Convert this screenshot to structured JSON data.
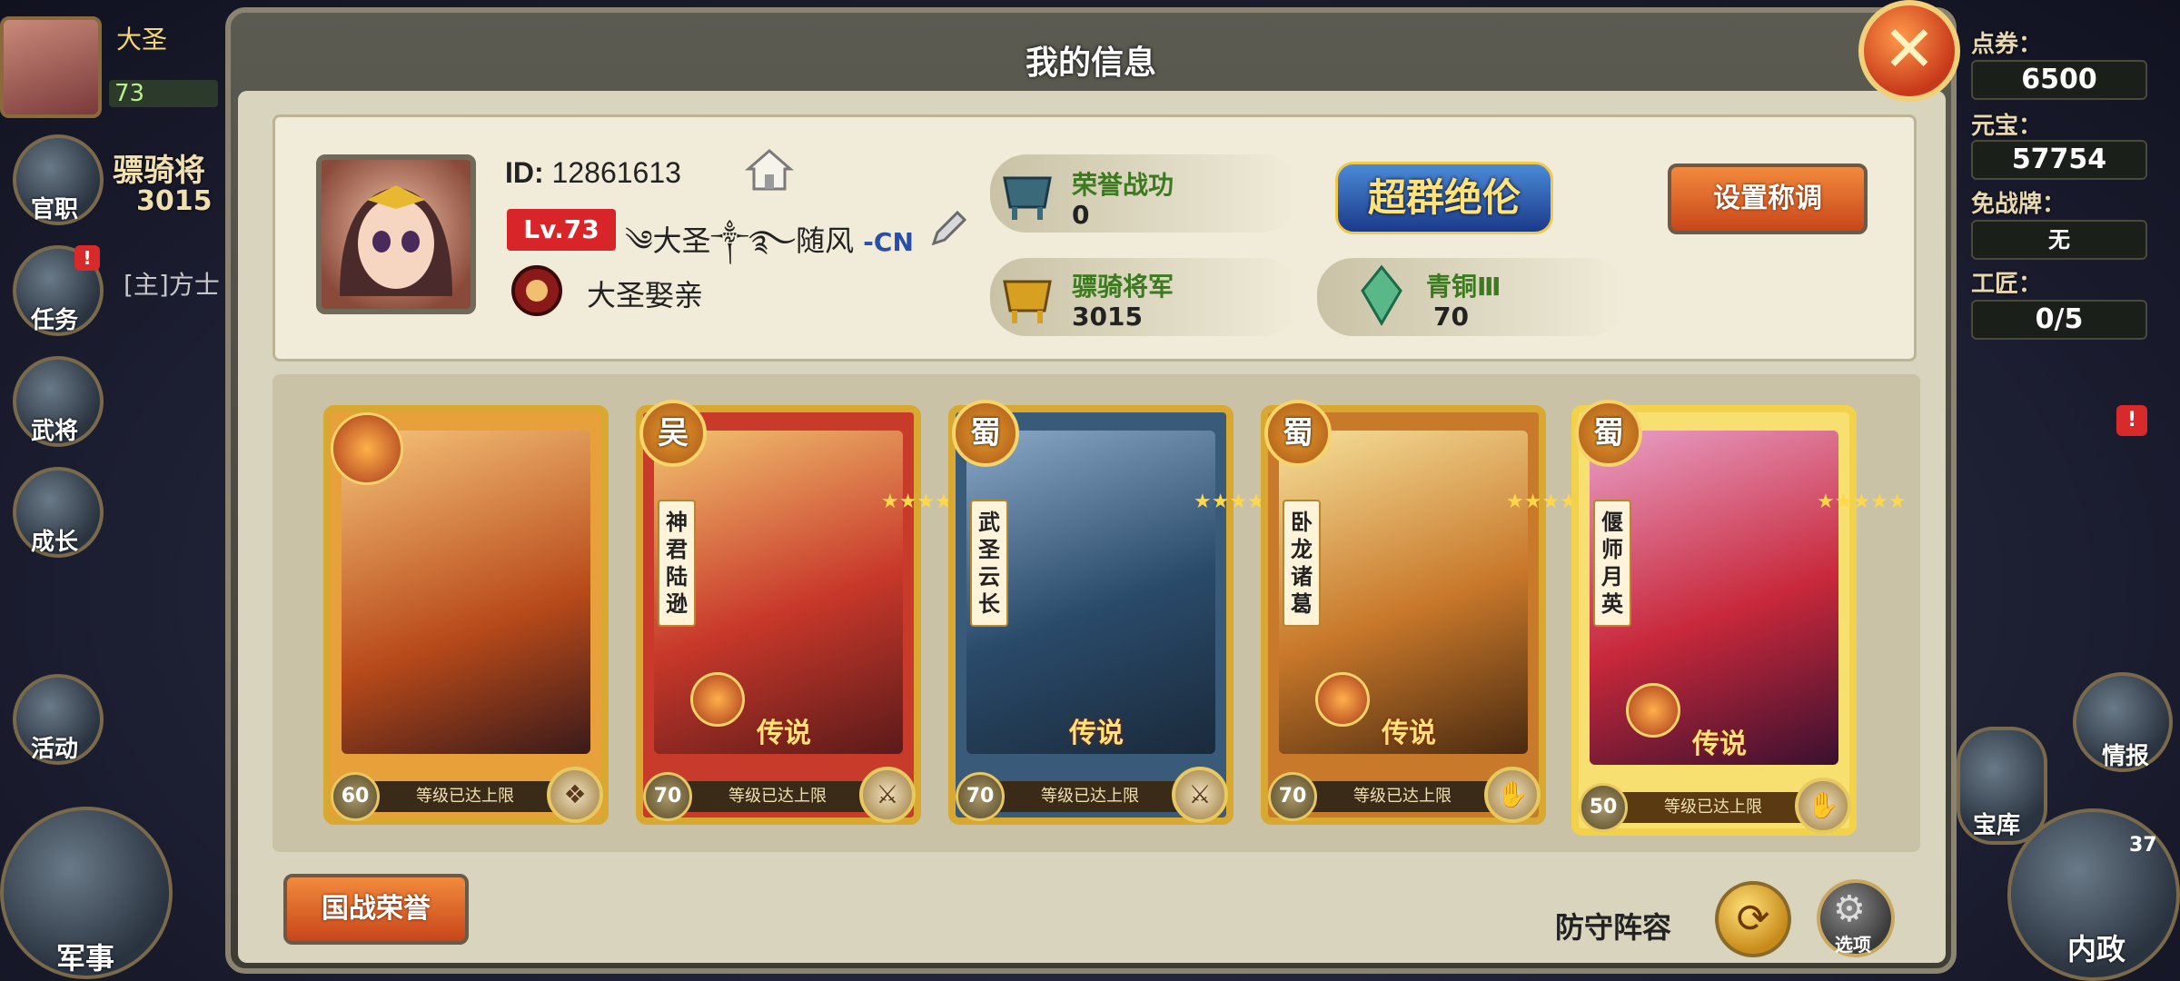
{
  "hud_left": {
    "player_name": "大圣",
    "level": "73",
    "rank_title": "骠骑将",
    "rank_value": "3015",
    "chat_preview": "[主]方士",
    "buttons": [
      {
        "label": "官职"
      },
      {
        "label": "任务",
        "badge": "!"
      },
      {
        "label": "武将"
      },
      {
        "label": "成长"
      },
      {
        "label": "活动"
      },
      {
        "label": "军事"
      }
    ]
  },
  "hud_right": {
    "coupon_label": "点券：",
    "coupon_value": "6500",
    "yuanbao_label": "元宝：",
    "yuanbao_value": "57754",
    "truce_label": "免战牌：",
    "truce_value": "无",
    "craftsman_label": "工匠：",
    "craftsman_value": "0/5",
    "intel_label": "情报",
    "treasury_label": "宝库",
    "politics_label": "内政",
    "politics_badge": "37",
    "alert_badge": "!"
  },
  "dialog": {
    "title": "我的信息",
    "close_symbol": "✕",
    "profile": {
      "id_label": "ID:",
      "id_value": "12861613",
      "level_badge": "Lv.73",
      "name": "༄大圣༒࿐随风",
      "server_tag": "-CN",
      "guild_name": "大圣娶亲"
    },
    "stats": {
      "honor_merit_label": "荣誉战功",
      "honor_merit_value": "0",
      "rank_label": "骠骑将军",
      "rank_value": "3015",
      "emblem_text": "超群绝伦",
      "tier_label": "青铜Ⅲ",
      "tier_value": "70"
    },
    "set_title_button": "设置称调",
    "nation_honor_button": "国战荣誉",
    "defense_lineup_label": "防守阵容",
    "options_label": "选项",
    "cards": [
      {
        "faction": "",
        "name": "",
        "level": "60",
        "rarity": "",
        "status": "等级已达上限"
      },
      {
        "faction": "吴",
        "name": "神君陆逊",
        "level": "70",
        "rarity": "传说",
        "status": "等级已达上限"
      },
      {
        "faction": "蜀",
        "name": "武圣云长",
        "level": "70",
        "rarity": "传说",
        "status": "等级已达上限"
      },
      {
        "faction": "蜀",
        "name": "卧龙诸葛",
        "level": "70",
        "rarity": "传说",
        "status": "等级已达上限"
      },
      {
        "faction": "蜀",
        "name": "偃师月英",
        "level": "50",
        "rarity": "传说",
        "status": "等级已达上限"
      }
    ],
    "colors": {
      "accent_orange": "#d8582a",
      "level_red": "#d8252a",
      "stat_green": "#3c7a20",
      "server_blue": "#2a4ea8"
    }
  }
}
